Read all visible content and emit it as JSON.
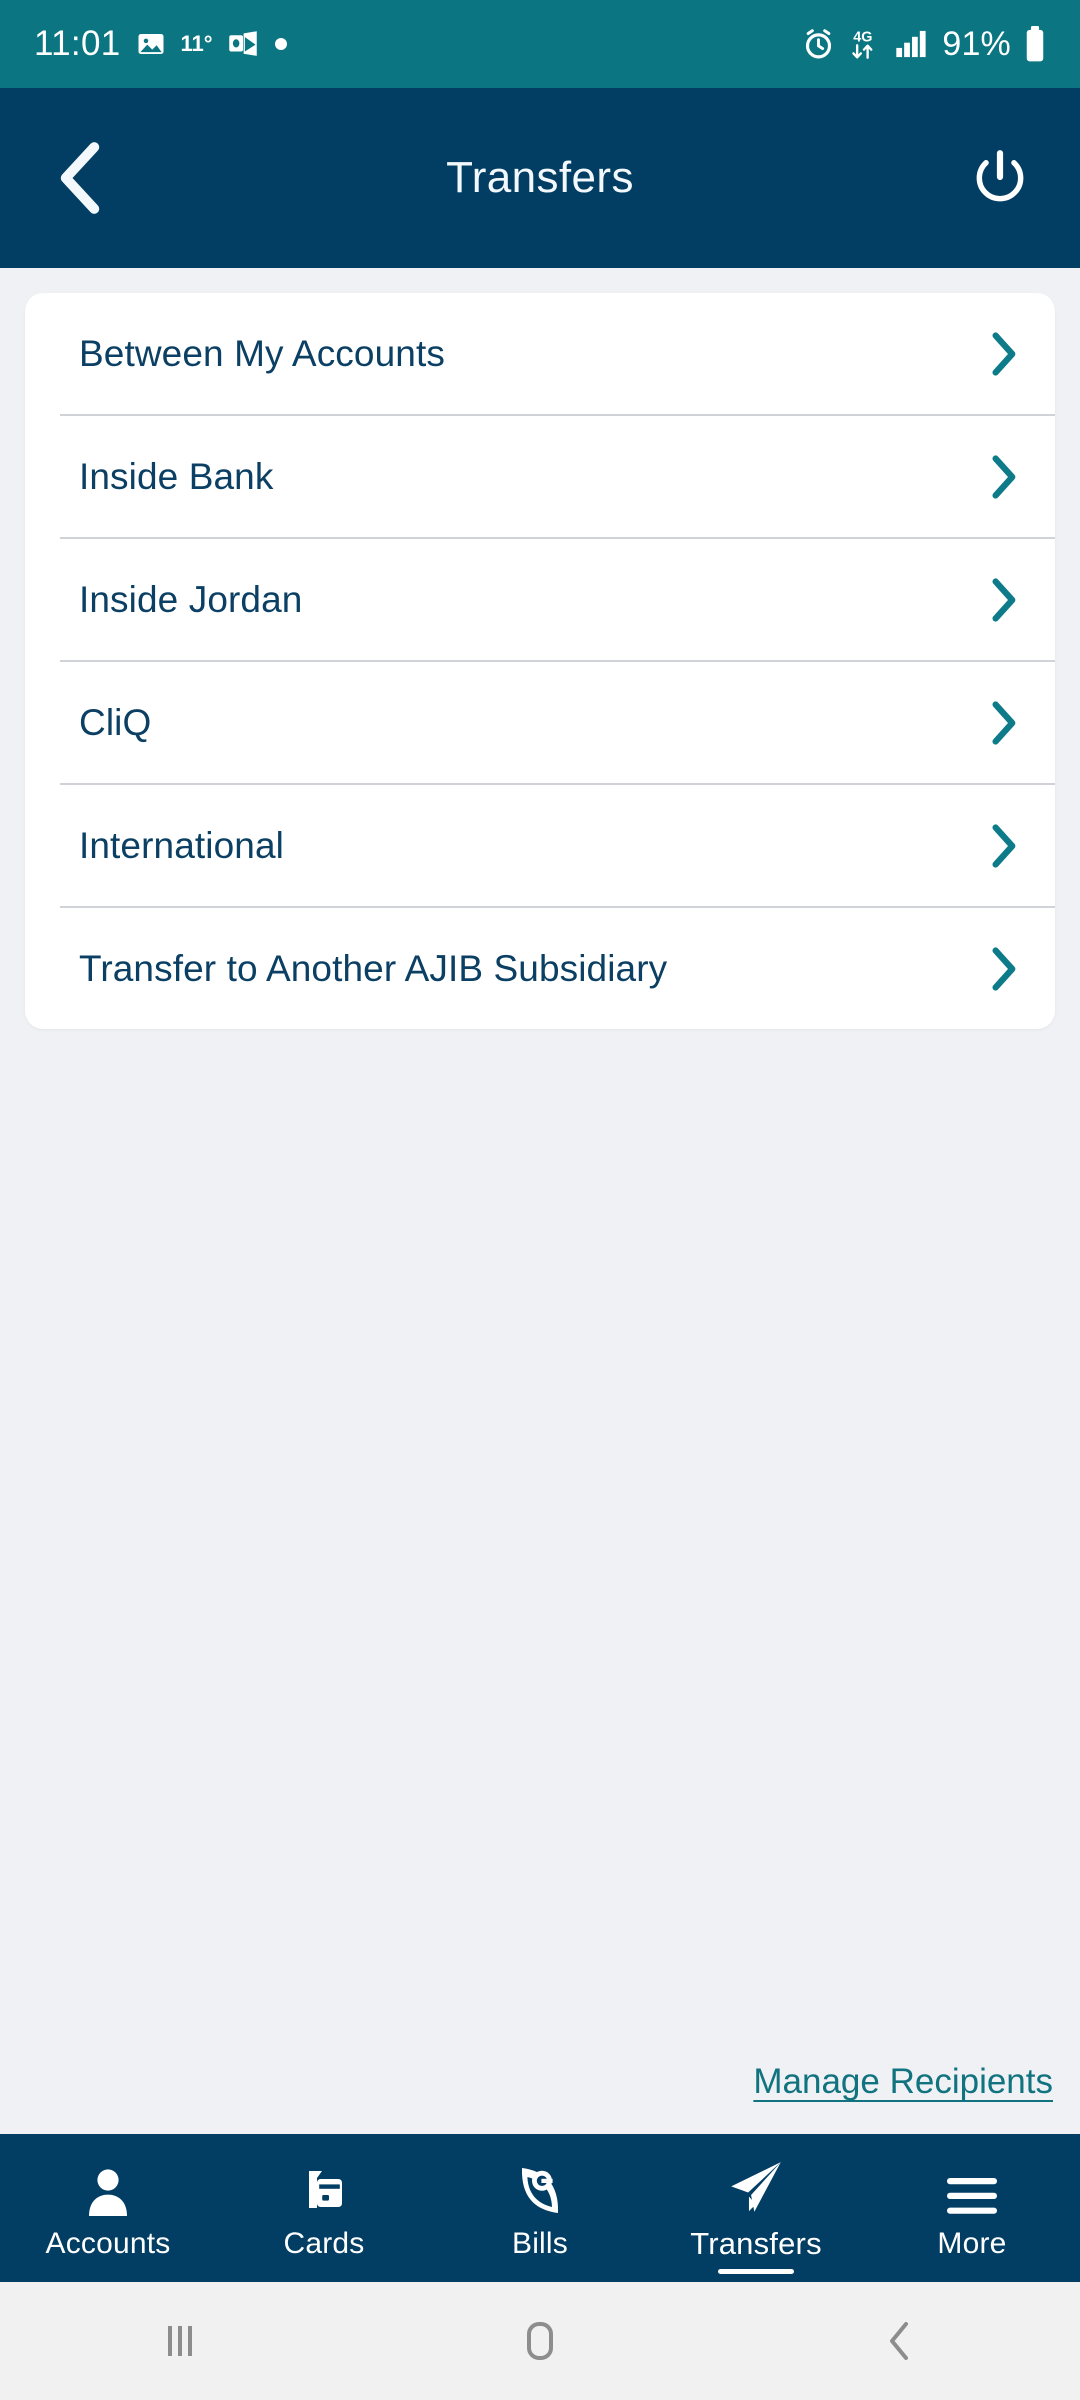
{
  "status_bar": {
    "time": "11:01",
    "temperature": "11°",
    "battery_percent": "91%",
    "network_type": "4G",
    "icons": [
      "gallery-icon",
      "outlook-icon",
      "dot-indicator-icon",
      "alarm-icon",
      "data-transfer-icon",
      "signal-icon",
      "battery-icon"
    ],
    "background_color": "#0b7682"
  },
  "header": {
    "title": "Transfers",
    "back_icon": "chevron-left-icon",
    "logout_icon": "power-icon",
    "background_color": "#023e63"
  },
  "transfer_list": {
    "items": [
      {
        "label": "Between My Accounts",
        "chevron": "chevron-right-icon"
      },
      {
        "label": "Inside Bank",
        "chevron": "chevron-right-icon"
      },
      {
        "label": "Inside Jordan",
        "chevron": "chevron-right-icon"
      },
      {
        "label": "CliQ",
        "chevron": "chevron-right-icon"
      },
      {
        "label": "International",
        "chevron": "chevron-right-icon"
      },
      {
        "label": "Transfer to Another AJIB Subsidiary",
        "chevron": "chevron-right-icon"
      }
    ],
    "label_color": "#0b3f63",
    "chevron_color": "#0d7b8a"
  },
  "manage_recipients": {
    "label": "Manage Recipients",
    "color": "#11737f"
  },
  "bottom_nav": {
    "items": [
      {
        "label": "Accounts",
        "icon": "person-icon",
        "active": false
      },
      {
        "label": "Cards",
        "icon": "credit-card-icon",
        "active": false
      },
      {
        "label": "Bills",
        "icon": "efawateercom-icon",
        "active": false
      },
      {
        "label": "Transfers",
        "icon": "paper-plane-icon",
        "active": true
      },
      {
        "label": "More",
        "icon": "hamburger-icon",
        "active": false
      }
    ],
    "background_color": "#023e63"
  },
  "system_nav": {
    "buttons": [
      {
        "name": "recents-button",
        "icon": "recents-icon"
      },
      {
        "name": "home-button",
        "icon": "home-icon"
      },
      {
        "name": "back-button",
        "icon": "back-icon"
      }
    ],
    "background_color": "#f1f1f1"
  }
}
